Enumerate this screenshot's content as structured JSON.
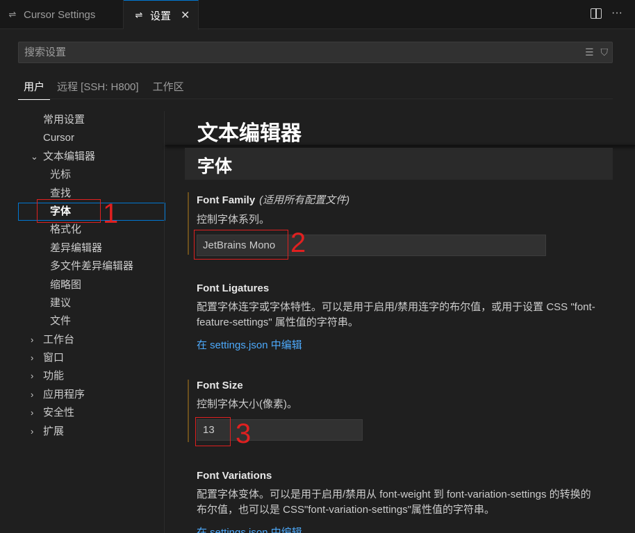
{
  "tabs": {
    "inactive_label": "Cursor Settings",
    "active_label": "设置",
    "close_glyph": "✕"
  },
  "search": {
    "placeholder": "搜索设置"
  },
  "scope_tabs": [
    "用户",
    "远程 [SSH: H800]",
    "工作区"
  ],
  "toc": [
    {
      "label": "常用设置",
      "level": 1,
      "chevron": ""
    },
    {
      "label": "Cursor",
      "level": 1,
      "chevron": ""
    },
    {
      "label": "文本编辑器",
      "level": 1,
      "chevron": "⌄"
    },
    {
      "label": "光标",
      "level": 2,
      "chevron": ""
    },
    {
      "label": "查找",
      "level": 2,
      "chevron": ""
    },
    {
      "label": "字体",
      "level": 2,
      "chevron": "",
      "selected": true
    },
    {
      "label": "格式化",
      "level": 2,
      "chevron": ""
    },
    {
      "label": "差异编辑器",
      "level": 2,
      "chevron": ""
    },
    {
      "label": "多文件差异编辑器",
      "level": 2,
      "chevron": ""
    },
    {
      "label": "缩略图",
      "level": 2,
      "chevron": ""
    },
    {
      "label": "建议",
      "level": 2,
      "chevron": ""
    },
    {
      "label": "文件",
      "level": 2,
      "chevron": ""
    },
    {
      "label": "工作台",
      "level": 1,
      "chevron": "›"
    },
    {
      "label": "窗口",
      "level": 1,
      "chevron": "›"
    },
    {
      "label": "功能",
      "level": 1,
      "chevron": "›"
    },
    {
      "label": "应用程序",
      "level": 1,
      "chevron": "›"
    },
    {
      "label": "安全性",
      "level": 1,
      "chevron": "›"
    },
    {
      "label": "扩展",
      "level": 1,
      "chevron": "›"
    }
  ],
  "content": {
    "heading": "文本编辑器",
    "subheading": "字体",
    "font_family": {
      "title": "Font Family",
      "scope_note": "(适用所有配置文件)",
      "description": "控制字体系列。",
      "value": "JetBrains Mono"
    },
    "font_ligatures": {
      "title": "Font Ligatures",
      "description": "配置字体连字或字体特性。可以是用于启用/禁用连字的布尔值，或用于设置 CSS \"font-feature-settings\" 属性值的字符串。",
      "link": "在 settings.json 中编辑"
    },
    "font_size": {
      "title": "Font Size",
      "description": "控制字体大小(像素)。",
      "value": "13"
    },
    "font_variations": {
      "title": "Font Variations",
      "description": "配置字体变体。可以是用于启用/禁用从 font-weight 到 font-variation-settings 的转换的布尔值，也可以是 CSS\"font-variation-settings\"属性值的字符串。",
      "link": "在 settings.json 中编辑"
    }
  },
  "annotations": [
    "1",
    "2",
    "3"
  ],
  "colors": {
    "background": "#1f1f1f",
    "accent": "#0078d4",
    "link": "#4daafc",
    "annotation": "#e02020",
    "modified_bar": "#6b4f1d"
  }
}
